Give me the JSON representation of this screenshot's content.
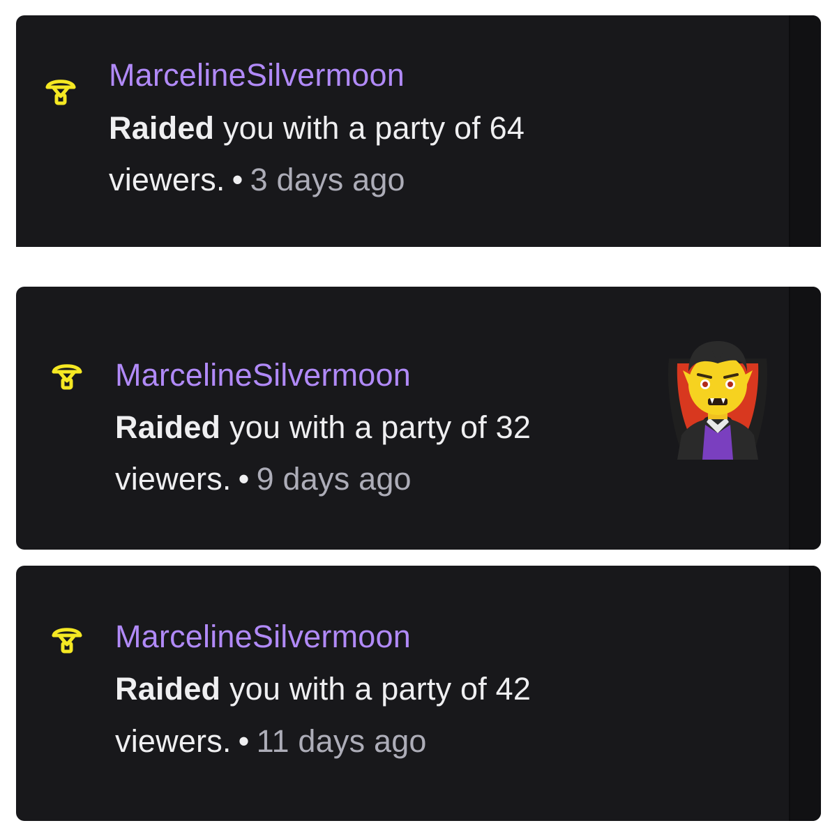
{
  "notifications": [
    {
      "username": "MarcelineSilvermoon",
      "action": "Raided",
      "message_rest": "you with a party of 64",
      "viewers_word": "viewers.",
      "separator": "•",
      "time_ago": "3 days ago",
      "icon": "raid-parachute-icon",
      "has_avatar": false
    },
    {
      "username": "MarcelineSilvermoon",
      "action": "Raided",
      "message_rest": "you with a party of 32",
      "viewers_word": "viewers.",
      "separator": "•",
      "time_ago": "9 days ago",
      "icon": "raid-parachute-icon",
      "has_avatar": true,
      "avatar_icon": "vampire-emoji-icon"
    },
    {
      "username": "MarcelineSilvermoon",
      "action": "Raided",
      "message_rest": "you with a party of 42",
      "viewers_word": "viewers.",
      "separator": "•",
      "time_ago": "11 days ago",
      "icon": "raid-parachute-icon",
      "has_avatar": false
    }
  ],
  "colors": {
    "card_background": "#18181b",
    "username": "#b18af8",
    "text": "#efeff1",
    "muted": "#adadb8",
    "icon": "#f5e823"
  }
}
